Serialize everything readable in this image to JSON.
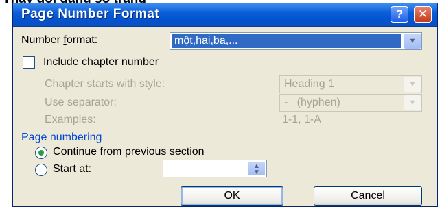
{
  "caption": "Thay đổi dạng số trang",
  "dialog": {
    "title": "Page Number Format",
    "help_glyph": "?",
    "close_glyph": "✕"
  },
  "number_format": {
    "label_pre": "Number ",
    "label_key": "f",
    "label_post": "ormat:",
    "value": "một,hai,ba,..."
  },
  "include_chapter": {
    "label_pre": "Include chapter ",
    "label_key": "n",
    "label_post": "umber",
    "checked": false
  },
  "chapter_style": {
    "label": "Chapter starts with style:",
    "value": "Heading 1"
  },
  "separator": {
    "label": "Use separator:",
    "value": "-   (hyphen)"
  },
  "examples": {
    "label": "Examples:",
    "value": "1-1, 1-A"
  },
  "page_numbering": {
    "heading": "Page numbering",
    "continue_key": "C",
    "continue_rest": "ontinue from previous section",
    "continue_selected": true,
    "start_pre": "Start ",
    "start_key": "a",
    "start_post": "t:",
    "start_value": ""
  },
  "buttons": {
    "ok": "OK",
    "cancel": "Cancel"
  },
  "glyphs": {
    "arrow_down": "▼",
    "spin_up": "▲",
    "spin_down": "▼"
  }
}
